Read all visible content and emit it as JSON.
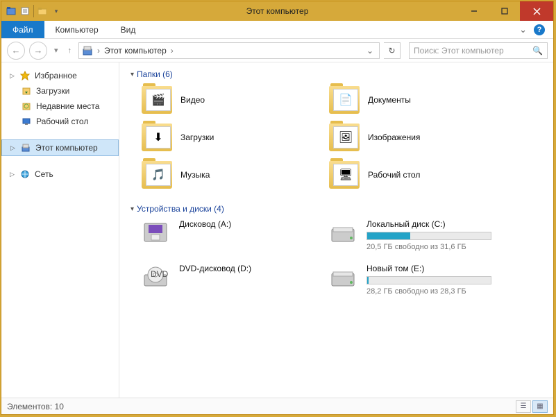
{
  "window": {
    "title": "Этот компьютер"
  },
  "ribbon": {
    "file": "Файл",
    "tabs": [
      "Компьютер",
      "Вид"
    ]
  },
  "address": {
    "location": "Этот компьютер"
  },
  "search": {
    "placeholder": "Поиск: Этот компьютер"
  },
  "sidebar": {
    "favorites": {
      "label": "Избранное",
      "items": [
        "Загрузки",
        "Недавние места",
        "Рабочий стол"
      ]
    },
    "this_pc": {
      "label": "Этот компьютер"
    },
    "network": {
      "label": "Сеть"
    }
  },
  "sections": {
    "folders": {
      "title": "Папки (6)",
      "items": [
        {
          "label": "Видео",
          "glyph": "🎬"
        },
        {
          "label": "Документы",
          "glyph": "📄"
        },
        {
          "label": "Загрузки",
          "glyph": "⬇"
        },
        {
          "label": "Изображения",
          "glyph": "🖼"
        },
        {
          "label": "Музыка",
          "glyph": "🎵"
        },
        {
          "label": "Рабочий стол",
          "glyph": "🖥"
        }
      ]
    },
    "drives": {
      "title": "Устройства и диски (4)",
      "items": [
        {
          "label": "Дисковод (A:)",
          "kind": "floppy"
        },
        {
          "label": "Локальный диск (C:)",
          "kind": "hdd",
          "sub": "20,5 ГБ свободно из 31,6 ГБ",
          "fill_pct": 35
        },
        {
          "label": "DVD-дисковод (D:)",
          "kind": "dvd"
        },
        {
          "label": "Новый том (E:)",
          "kind": "hdd",
          "sub": "28,2 ГБ свободно из 28,3 ГБ",
          "fill_pct": 1
        }
      ]
    }
  },
  "status": {
    "text": "Элементов: 10"
  }
}
